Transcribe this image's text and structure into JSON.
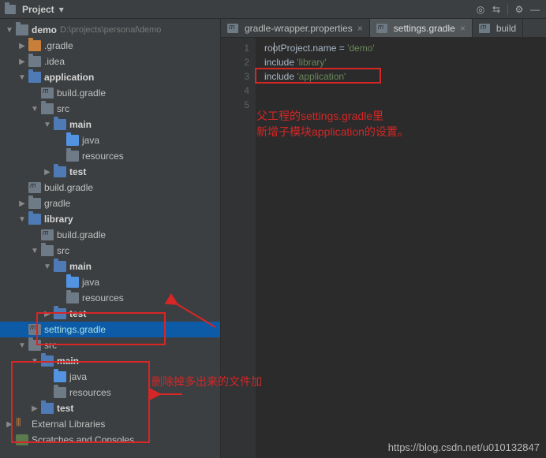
{
  "toolbar": {
    "project_label": "Project"
  },
  "project": {
    "root_name": "demo",
    "root_path": "D:\\projects\\personal\\demo",
    "items": [
      {
        "name": ".gradle"
      },
      {
        "name": ".idea"
      },
      {
        "name": "application",
        "children": [
          {
            "name": "build.gradle"
          },
          {
            "name": "src",
            "children": [
              {
                "name": "main",
                "children": [
                  {
                    "name": "java"
                  },
                  {
                    "name": "resources"
                  }
                ]
              },
              {
                "name": "test"
              }
            ]
          }
        ]
      },
      {
        "name": "build.gradle"
      },
      {
        "name": "gradle"
      },
      {
        "name": "library",
        "children": [
          {
            "name": "build.gradle"
          },
          {
            "name": "src",
            "children": [
              {
                "name": "main",
                "children": [
                  {
                    "name": "java"
                  },
                  {
                    "name": "resources"
                  }
                ]
              },
              {
                "name": "test"
              }
            ]
          }
        ]
      },
      {
        "name": "settings.gradle"
      },
      {
        "name": "src",
        "children": [
          {
            "name": "main",
            "children": [
              {
                "name": "java"
              },
              {
                "name": "resources"
              }
            ]
          },
          {
            "name": "test"
          }
        ]
      }
    ],
    "external_libraries": "External Libraries",
    "scratches": "Scratches and Consoles"
  },
  "tabs": [
    {
      "label": "gradle-wrapper.properties",
      "active": false
    },
    {
      "label": "settings.gradle",
      "active": true
    },
    {
      "label": "build",
      "active": false
    }
  ],
  "code": {
    "lines": [
      {
        "n": 1,
        "tokens": [
          {
            "t": "rootProject",
            "c": "id"
          },
          {
            "t": ".name = ",
            "c": "id"
          },
          {
            "t": "'demo'",
            "c": "str"
          }
        ]
      },
      {
        "n": 2,
        "tokens": [
          {
            "t": "include ",
            "c": "id"
          },
          {
            "t": "'library'",
            "c": "str"
          }
        ]
      },
      {
        "n": 3,
        "tokens": [
          {
            "t": "include ",
            "c": "id"
          },
          {
            "t": "'application'",
            "c": "str"
          }
        ]
      },
      {
        "n": 4,
        "tokens": []
      },
      {
        "n": 5,
        "tokens": []
      }
    ]
  },
  "annotations": {
    "comment1_line1": "父工程的settings.gradle里",
    "comment1_line2": "新增子模块application的设置。",
    "comment2": "删除掉多出来的文件加"
  },
  "watermark": "https://blog.csdn.net/u010132847"
}
